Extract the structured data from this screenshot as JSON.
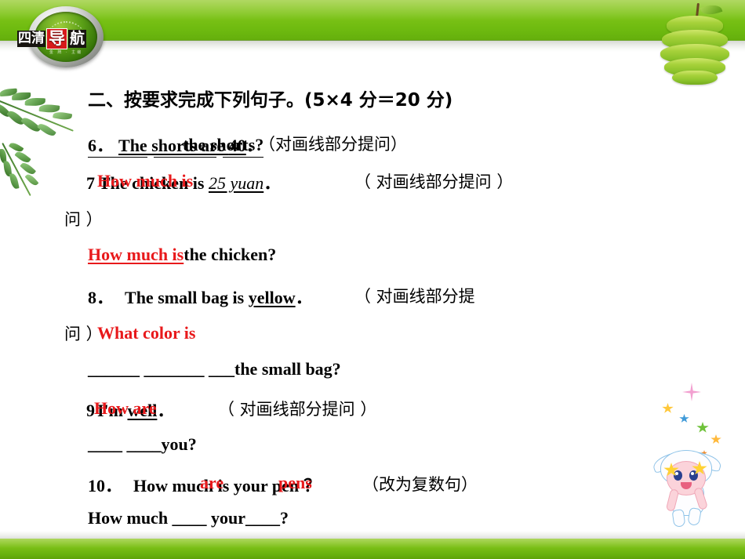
{
  "header": {
    "logo_text_1": "四清",
    "logo_text_2": "导",
    "logo_text_3": "航",
    "logo_subtitle": "金 牌 · 主编",
    "decor_left": "fern-leaves",
    "decor_right": "sliced-green-apple"
  },
  "content": {
    "section_title": "二、按要求完成下列句子。(5×4 分＝20 分)",
    "items": [
      {
        "number": "6．",
        "sentence_before": "The shorts are ",
        "underlined_answer": "40",
        "sentence_after": "．",
        "instruction": "（对画线部分提问）",
        "overlay_answer": "the shorts?",
        "overlay_color": "#000000"
      },
      {
        "number": "7",
        "sentence_before": "The chicken is ",
        "underlined_answer": "25 yuan",
        "sentence_after": "．",
        "instruction": "（ 对画线部分提问 ）",
        "overlay_answer": "How much is",
        "overlay_color": "#e8191b"
      },
      {
        "answer_line_red": "How much  is",
        "answer_line_black": "the chicken?"
      },
      {
        "number": "8．",
        "sentence_before": "The small bag is ",
        "underlined_answer": "yellow",
        "sentence_after": "．",
        "instruction": "（ 对画线部分提",
        "instruction_cont": "问 ）",
        "overlay_answer": "What    color    is",
        "overlay_color": "#e8191b"
      },
      {
        "answer_blanks": "______  _______  ___",
        "answer_tail": "the small bag?"
      },
      {
        "number": "9",
        "sentence_before": "I'm ",
        "underlined_answer": "well",
        "sentence_after": "．",
        "instruction": "（ 对画线部分提问 ）",
        "overlay_answer": "How are",
        "overlay_color": "#e8191b"
      },
      {
        "answer_blanks": "____  ____",
        "answer_tail": "you?"
      },
      {
        "number": "10．",
        "sentence_before": "How much is your pen",
        "sentence_after": "？",
        "instruction": "（改为复数句）",
        "overlay_answer_1": "are",
        "overlay_answer_2": "pens",
        "overlay_color": "#e8191b"
      },
      {
        "answer_line": "How much ____ your____?"
      }
    ],
    "q7_wrap": "问 ）"
  },
  "colors": {
    "brand_green": "#7ec418",
    "answer_red": "#e8191b",
    "text_black": "#000000"
  },
  "mascot": {
    "name": "bunny-mascot",
    "star_colors": [
      "#f2a0d0",
      "#ffc83b",
      "#3f9ad8",
      "#6fc23a",
      "#ffb93b",
      "#f08a2a"
    ]
  }
}
